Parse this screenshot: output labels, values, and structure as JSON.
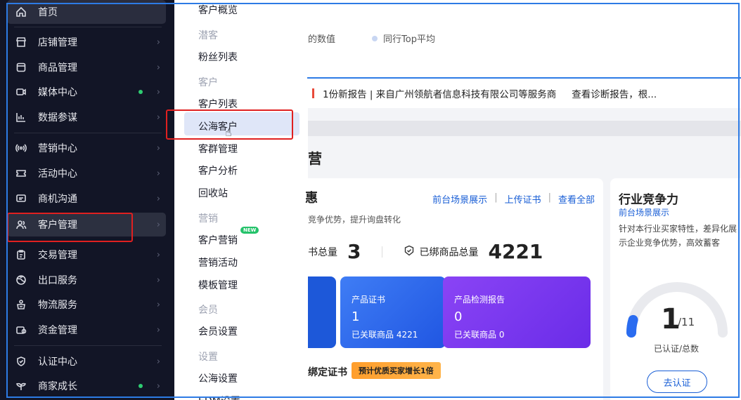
{
  "sidebar": {
    "items": [
      {
        "label": "首页",
        "icon": "home-icon"
      },
      {
        "label": "店铺管理",
        "icon": "store-icon"
      },
      {
        "label": "商品管理",
        "icon": "product-icon"
      },
      {
        "label": "媒体中心",
        "icon": "media-icon"
      },
      {
        "label": "数据参谋",
        "icon": "data-chart-icon"
      },
      {
        "label": "营销中心",
        "icon": "broadcast-icon"
      },
      {
        "label": "活动中心",
        "icon": "ticket-icon"
      },
      {
        "label": "商机沟通",
        "icon": "message-icon"
      },
      {
        "label": "客户管理",
        "icon": "users-icon"
      },
      {
        "label": "交易管理",
        "icon": "clipboard-icon"
      },
      {
        "label": "出口服务",
        "icon": "globe-icon"
      },
      {
        "label": "物流服务",
        "icon": "logistics-icon"
      },
      {
        "label": "资金管理",
        "icon": "wallet-icon"
      },
      {
        "label": "认证中心",
        "icon": "shield-icon"
      },
      {
        "label": "商家成长",
        "icon": "sprout-icon"
      }
    ]
  },
  "submenu": {
    "overview": "客户概览",
    "g_lead": "潜客",
    "fans": "粉丝列表",
    "g_customer": "客户",
    "customer_list": "客户列表",
    "public_customer": "公海客户",
    "groups": "客群管理",
    "analysis": "客户分析",
    "recycle": "回收站",
    "g_marketing": "营销",
    "cust_marketing": "客户营销",
    "new_badge": "NEW",
    "campaign": "营销活动",
    "templates": "模板管理",
    "g_member": "会员",
    "member_settings": "会员设置",
    "g_settings": "设置",
    "sea_settings": "公海设置",
    "partial": "EDM设置"
  },
  "main": {
    "legend_a": "的数值",
    "legend_b": "同行Top平均",
    "notice_text": "1份新报告 | 来自广州领航者信息科技有限公司等服务商",
    "notice_link": "查看诊断报告，根...",
    "section_title_partial": "营",
    "card": {
      "title_partial": "惠",
      "link_scene": "前台场景展示",
      "link_upload": "上传证书",
      "link_all": "查看全部",
      "divider": "|",
      "subtitle_partial": "竞争优势，提升询盘转化",
      "stat1_label": "书总量",
      "stat1_value": "3",
      "stat2_label": "已绑商品总量",
      "stat2_value": "4221",
      "tiles": [
        {
          "title": "产品证书",
          "value": "1",
          "sub": "已关联商品 4221",
          "color": "#2b63e6"
        },
        {
          "title": "产品检测报告",
          "value": "0",
          "sub": "已关联商品 0",
          "color": "#7a35f0"
        }
      ],
      "bind_title_partial": "绑定证书",
      "badge": "预计优质买家增长1倍"
    },
    "industry": {
      "title": "行业竞争力",
      "link": "前台场景展示",
      "desc": "针对本行业买家特性，差异化展示企业竞争优势，高效蓄客",
      "value": "1",
      "total": "/11",
      "progress": 0.09,
      "label": "已认证/总数",
      "button": "去认证"
    }
  },
  "colors": {
    "sidebar_bg": "#121526",
    "accent": "#1a5fd6",
    "highlight_red": "#e02020",
    "frame_blue": "#2d7be5"
  }
}
